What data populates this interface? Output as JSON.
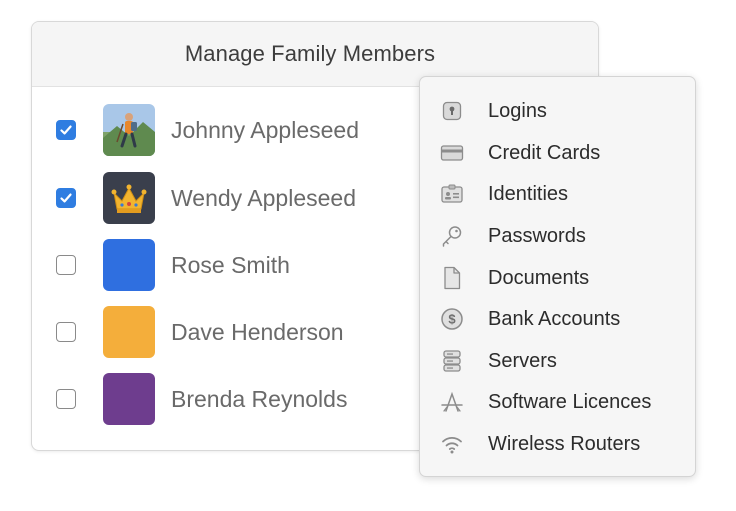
{
  "panel": {
    "title": "Manage Family Members"
  },
  "members": [
    {
      "name": "Johnny Appleseed",
      "checked": true,
      "avatar": "hiker-avatar"
    },
    {
      "name": "Wendy Appleseed",
      "checked": true,
      "avatar": "crown-avatar",
      "color": "#3a3f4c"
    },
    {
      "name": "Rose Smith",
      "checked": false,
      "avatar": "color-swatch",
      "color": "#2f6fe0"
    },
    {
      "name": "Dave Henderson",
      "checked": false,
      "avatar": "color-swatch",
      "color": "#f4ae3b"
    },
    {
      "name": "Brenda Reynolds",
      "checked": false,
      "avatar": "color-swatch",
      "color": "#6e3d8e"
    }
  ],
  "menu": {
    "items": [
      {
        "label": "Logins",
        "icon": "keyhole-icon"
      },
      {
        "label": "Credit Cards",
        "icon": "credit-card-icon"
      },
      {
        "label": "Identities",
        "icon": "id-card-icon"
      },
      {
        "label": "Passwords",
        "icon": "key-icon"
      },
      {
        "label": "Documents",
        "icon": "document-icon"
      },
      {
        "label": "Bank Accounts",
        "icon": "dollar-coin-icon"
      },
      {
        "label": "Servers",
        "icon": "server-icon"
      },
      {
        "label": "Software Licences",
        "icon": "app-store-icon"
      },
      {
        "label": "Wireless Routers",
        "icon": "wifi-icon"
      }
    ]
  },
  "colors": {
    "accent": "#2f7de1",
    "icon_gray": "#8c8c8c"
  }
}
